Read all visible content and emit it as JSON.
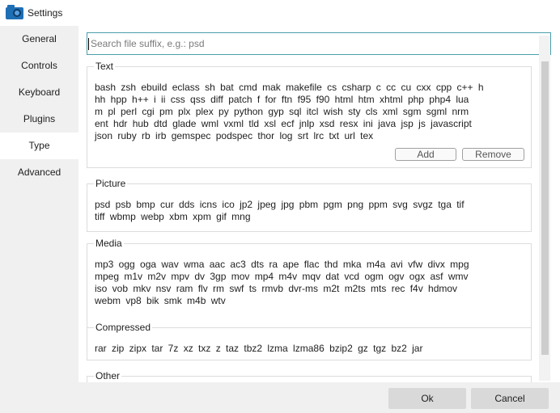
{
  "window": {
    "title": "Settings",
    "app_icon": "camera-folder-icon",
    "accent": "#1f6fb5"
  },
  "sidebar": {
    "active": "Type",
    "items": [
      {
        "label": "General"
      },
      {
        "label": "Controls"
      },
      {
        "label": "Keyboard"
      },
      {
        "label": "Plugins"
      },
      {
        "label": "Type"
      },
      {
        "label": "Advanced"
      }
    ]
  },
  "search": {
    "placeholder": "Search file suffix, e.g.: psd",
    "value": ""
  },
  "groups": {
    "text": {
      "title": "Text",
      "lines": [
        "bash zsh ebuild eclass sh bat cmd mak makefile cs csharp c cc cu cxx cpp c++ h",
        "hh hpp h++ i ii css qss diff patch f for ftn f95 f90 html htm xhtml php php4 lua",
        "m pl perl cgi pm plx plex py python gyp sql itcl wish sty cls xml sgm sgml nrm",
        "ent hdr hub dtd glade wml vxml tld xsl ecf jnlp xsd resx ini java jsp js javascript",
        "json ruby rb irb gemspec podspec thor log srt lrc txt url tex"
      ],
      "add_label": "Add",
      "remove_label": "Remove"
    },
    "picture": {
      "title": "Picture",
      "lines": [
        "psd psb bmp cur dds icns ico jp2 jpeg jpg pbm pgm png ppm svg svgz tga tif",
        "tiff wbmp webp xbm xpm gif mng"
      ]
    },
    "media": {
      "title": "Media",
      "lines": [
        "mp3 ogg oga wav wma aac ac3 dts ra ape flac thd mka m4a avi vfw divx mpg",
        "mpeg m1v m2v mpv dv 3gp mov mp4 m4v mqv dat vcd ogm ogv ogx asf wmv",
        "iso vob mkv nsv ram flv rm swf ts rmvb dvr-ms m2t m2ts mts rec f4v hdmov",
        "webm vp8 bik smk m4b wtv"
      ]
    },
    "compressed": {
      "title": "Compressed",
      "lines": [
        "rar zip zipx tar 7z xz txz z taz tbz2 lzma lzma86 bzip2 gz tgz bz2 jar"
      ]
    },
    "other": {
      "title": "Other"
    }
  },
  "footer": {
    "ok_label": "Ok",
    "cancel_label": "Cancel"
  }
}
